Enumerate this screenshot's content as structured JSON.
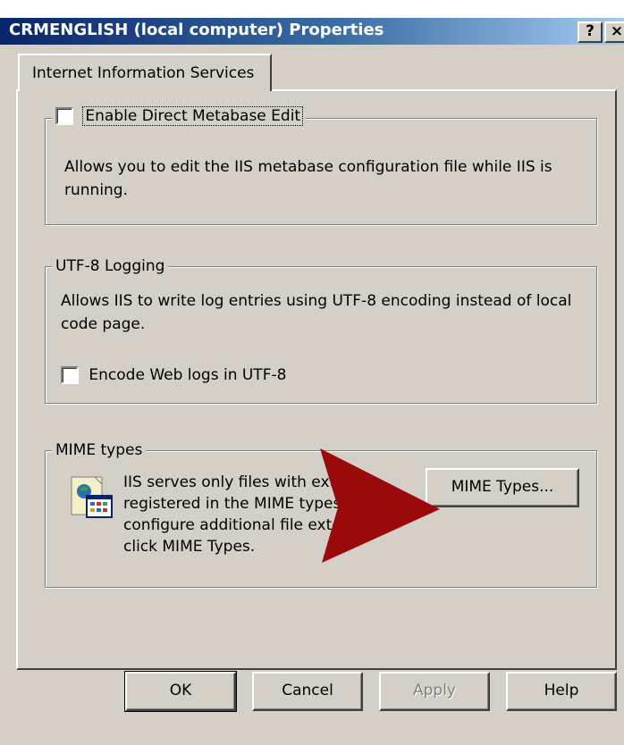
{
  "window": {
    "title": "CRMENGLISH (local computer) Properties",
    "help_btn": "?",
    "close_btn": "×"
  },
  "tabs": [
    {
      "label": "Internet Information Services",
      "active": true
    }
  ],
  "metabase_group": {
    "checkbox_label": "Enable Direct Metabase Edit",
    "checked": false,
    "description": "Allows you to edit the IIS metabase configuration file while IIS is running."
  },
  "utf8_group": {
    "legend": "UTF-8 Logging",
    "description": "Allows IIS to write log entries using UTF-8 encoding instead of local code page.",
    "checkbox_label": "Encode Web logs in UTF-8",
    "checked": false
  },
  "mime_group": {
    "legend": "MIME types",
    "description_lines": [
      "IIS serves only files with exte",
      "registered in the MIME types",
      "configure additional file exte  ions,",
      "click MIME Types."
    ],
    "button_label": "MIME Types...",
    "icon": "application-window-icon"
  },
  "annotation": {
    "shape": "red-arrow",
    "color": "#9b0a0a"
  },
  "footer_buttons": [
    {
      "label": "OK",
      "enabled": true
    },
    {
      "label": "Cancel",
      "enabled": true
    },
    {
      "label": "Apply",
      "enabled": false
    },
    {
      "label": "Help",
      "enabled": true
    }
  ]
}
